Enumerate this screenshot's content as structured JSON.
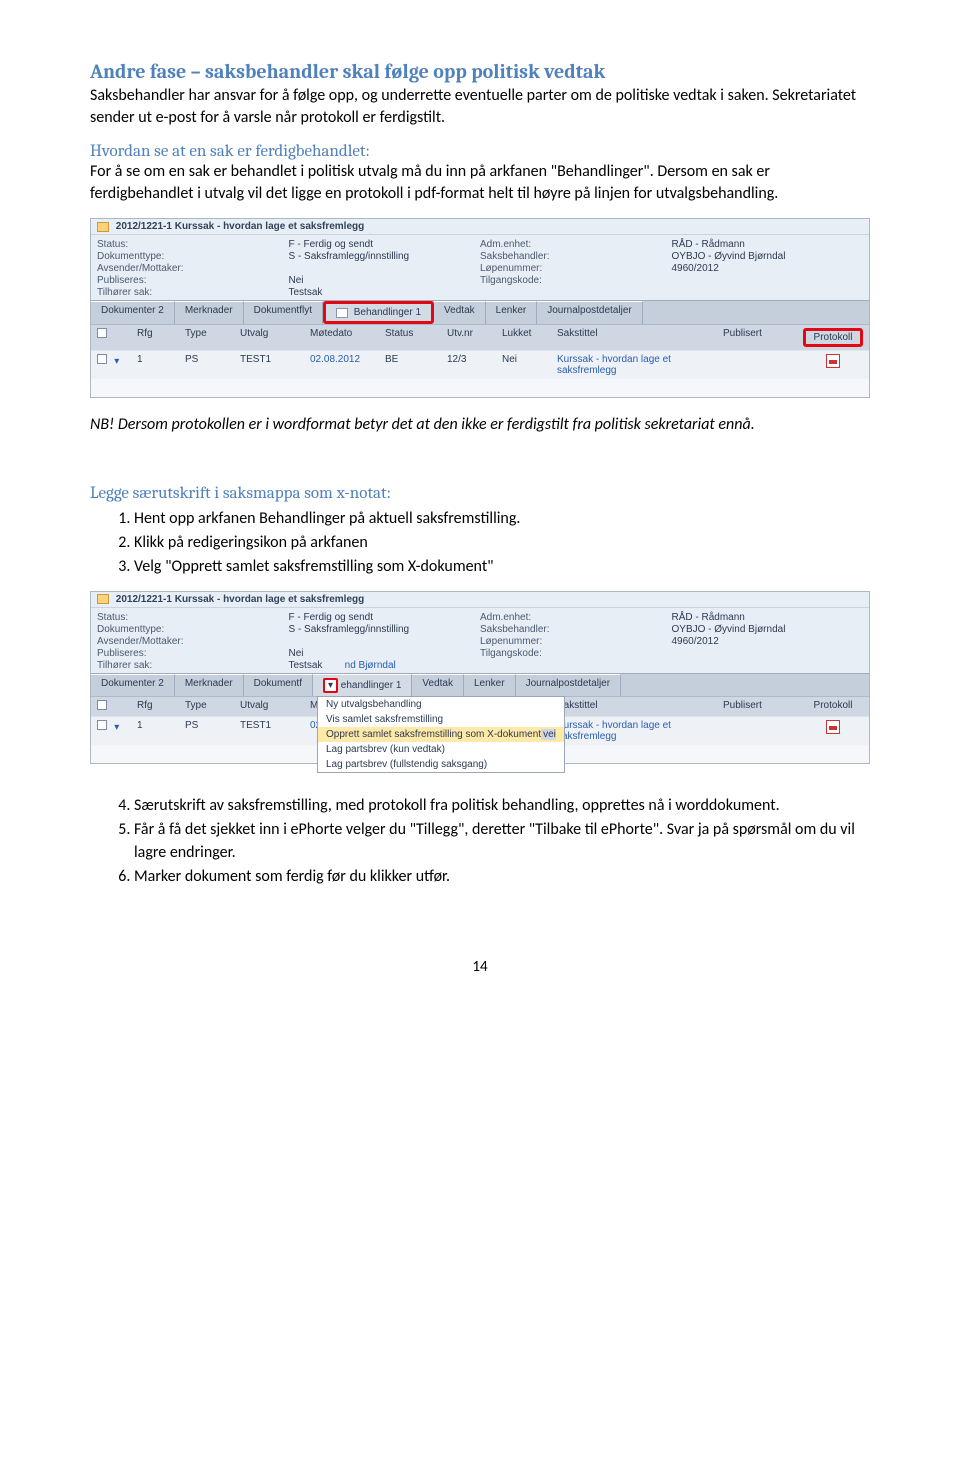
{
  "h2": "Andre fase – saksbehandler skal følge opp politisk vedtak",
  "p1": "Saksbehandler har ansvar for å følge opp, og underrette eventuelle parter om de politiske vedtak i saken. Sekretariatet sender ut e-post for å varsle når protokoll er ferdigstilt.",
  "sub1": "Hvordan se at en sak er ferdigbehandlet:",
  "p2": "For å se om en sak er behandlet i politisk utvalg må du inn på arkfanen \"Behandlinger\". Dersom en sak er ferdigbehandlet i utvalg vil det ligge en protokoll i pdf-format helt til høyre på linjen for utvalgsbehandling.",
  "nb": "NB! Dersom protokollen er i wordformat betyr det at den ikke er ferdigstilt fra politisk sekretariat ennå.",
  "section2": "Legge særutskrift i saksmappa som x-notat:",
  "ol1": {
    "i1": "Hent opp arkfanen Behandlinger på aktuell saksfremstilling.",
    "i2": "Klikk på redigeringsikon på arkfanen",
    "i3": "Velg \"Opprett samlet saksfremstilling som X-dokument\""
  },
  "ol2": {
    "i4": "Særutskrift av saksfremstilling, med protokoll fra politisk behandling, opprettes nå i worddokument.",
    "i5": "Får å få det sjekket inn i ePhorte velger du \"Tillegg\", deretter \"Tilbake til ePhorte\". Svar ja på spørsmål om du vil lagre endringer.",
    "i6": "Marker dokument som ferdig før du klikker utfør."
  },
  "pagenum": "14",
  "shot": {
    "title": "2012/1221-1 Kurssak - hvordan lage et saksfremlegg",
    "labels": {
      "status": "Status:",
      "doktype": "Dokumenttype:",
      "avs": "Avsender/Mottaker:",
      "pub": "Publiseres:",
      "tilh": "Tilhører sak:",
      "adm": "Adm.enhet:",
      "saksb": "Saksbehandler:",
      "lope": "Løpenummer:",
      "tilg": "Tilgangskode:"
    },
    "vals": {
      "status": "F - Ferdig og sendt",
      "doktype": "S - Saksframlegg/innstilling",
      "pub": "Nei",
      "tilh": "Testsak",
      "tilh2": "nd Bjørndal",
      "adm": "RÅD - Rådmann",
      "saksb": "OYBJO - Øyvind Bjørndal",
      "lope": "4960/2012"
    },
    "tabs": {
      "t1": "Dokumenter 2",
      "t2": "Merknader",
      "t3": "Dokumentflyt",
      "t4": "Behandlinger 1",
      "t5": "Vedtak",
      "t6": "Lenker",
      "t7": "Journalpostdetaljer"
    },
    "cols": {
      "rfg": "Rfg",
      "type": "Type",
      "utv": "Utvalg",
      "mtd": "Møtedato",
      "stat": "Status",
      "utvnr": "Utv.nr",
      "luk": "Lukket",
      "tit": "Sakstittel",
      "pub": "Publisert",
      "prot": "Protokoll"
    },
    "row": {
      "rfg": "1",
      "type": "PS",
      "utv": "TEST1",
      "mtd": "02.08.2012",
      "mtd2": "02",
      "stat": "BE",
      "utvnr": "12/3",
      "luk": "Nei",
      "tit": "Kurssak - hvordan lage et saksfremlegg"
    },
    "menu": {
      "m1": "Ny utvalgsbehandling",
      "m2": "Vis samlet saksfremstilling",
      "m3": "Opprett samlet saksfremstilling som X-dokument",
      "m4": "Lag partsbrev (kun vedtak)",
      "m5": "Lag partsbrev (fullstendig saksgang)",
      "m3suffix": "vei"
    }
  }
}
